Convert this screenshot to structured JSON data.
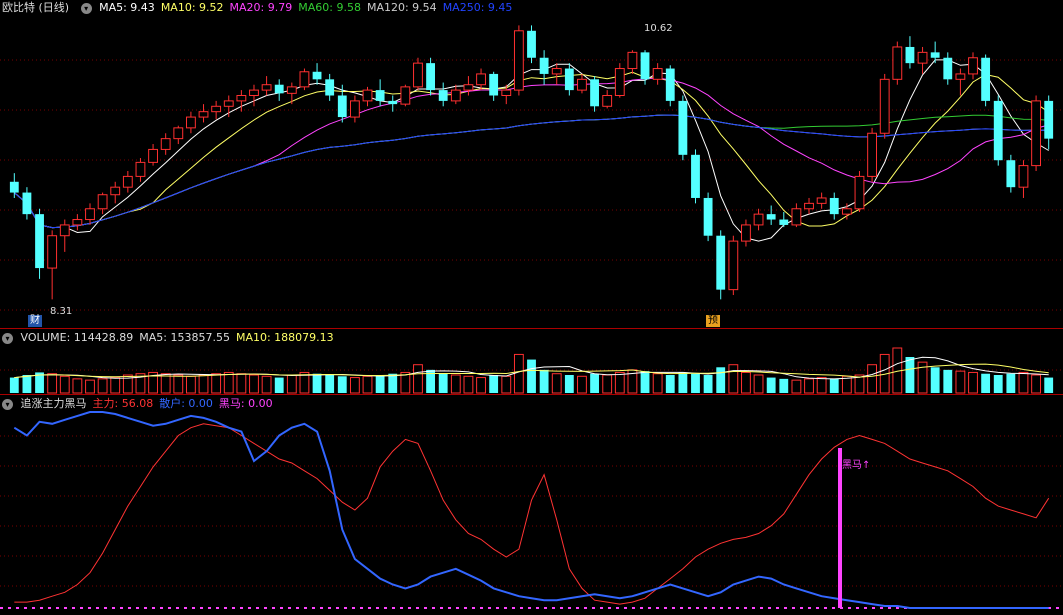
{
  "main": {
    "title": "欧比特 (日线)",
    "ma": [
      {
        "label": "MA5: 9.43",
        "color": "#ffffff"
      },
      {
        "label": "MA10: 9.52",
        "color": "#ffff66"
      },
      {
        "label": "MA20: 9.79",
        "color": "#ff44ff"
      },
      {
        "label": "MA60: 9.58",
        "color": "#33cc33"
      },
      {
        "label": "MA120: 9.54",
        "color": "#cccccc"
      },
      {
        "label": "MA250: 9.45",
        "color": "#2244ff"
      }
    ],
    "high_label": "10.62",
    "low_label": "8.31",
    "marker_cai": "财",
    "marker_yu": "预"
  },
  "volume": {
    "items": [
      {
        "label": "VOLUME: 114428.89",
        "color": "#dddddd"
      },
      {
        "label": "MA5: 153857.55",
        "color": "#dddddd"
      },
      {
        "label": "MA10: 188079.13",
        "color": "#ffff66"
      }
    ]
  },
  "indicator": {
    "items": [
      {
        "label": "追涨主力黑马",
        "color": "#dddddd"
      },
      {
        "label": "主力: 56.08",
        "color": "#ff3333"
      },
      {
        "label": "散户: 0.00",
        "color": "#3366ff"
      },
      {
        "label": "黑马: 0.00",
        "color": "#ff44ff"
      }
    ],
    "marker_label": "黑马↑"
  },
  "chart_data": [
    {
      "type": "candlestick",
      "ylim": [
        8.1,
        10.9
      ],
      "candles": [
        [
          9.4,
          9.48,
          9.25,
          9.3
        ],
        [
          9.3,
          9.35,
          9.05,
          9.1
        ],
        [
          9.1,
          9.15,
          8.5,
          8.6
        ],
        [
          8.6,
          8.95,
          8.31,
          8.9
        ],
        [
          8.9,
          9.05,
          8.75,
          9.0
        ],
        [
          9.0,
          9.1,
          8.95,
          9.05
        ],
        [
          9.05,
          9.2,
          9.0,
          9.15
        ],
        [
          9.15,
          9.3,
          9.1,
          9.28
        ],
        [
          9.28,
          9.4,
          9.2,
          9.35
        ],
        [
          9.35,
          9.5,
          9.3,
          9.45
        ],
        [
          9.45,
          9.62,
          9.4,
          9.58
        ],
        [
          9.58,
          9.75,
          9.55,
          9.7
        ],
        [
          9.7,
          9.85,
          9.65,
          9.8
        ],
        [
          9.8,
          9.92,
          9.75,
          9.9
        ],
        [
          9.9,
          10.05,
          9.85,
          10.0
        ],
        [
          10.0,
          10.12,
          9.95,
          10.05
        ],
        [
          10.05,
          10.15,
          9.98,
          10.1
        ],
        [
          10.1,
          10.2,
          10.0,
          10.15
        ],
        [
          10.15,
          10.25,
          10.05,
          10.2
        ],
        [
          10.2,
          10.3,
          10.1,
          10.25
        ],
        [
          10.25,
          10.38,
          10.2,
          10.3
        ],
        [
          10.3,
          10.35,
          10.15,
          10.22
        ],
        [
          10.22,
          10.32,
          10.12,
          10.28
        ],
        [
          10.28,
          10.45,
          10.25,
          10.42
        ],
        [
          10.42,
          10.5,
          10.3,
          10.35
        ],
        [
          10.35,
          10.4,
          10.15,
          10.2
        ],
        [
          10.2,
          10.3,
          9.95,
          10.0
        ],
        [
          10.0,
          10.2,
          9.95,
          10.15
        ],
        [
          10.15,
          10.28,
          10.1,
          10.25
        ],
        [
          10.25,
          10.35,
          10.1,
          10.15
        ],
        [
          10.15,
          10.2,
          10.05,
          10.12
        ],
        [
          10.12,
          10.3,
          10.1,
          10.28
        ],
        [
          10.28,
          10.55,
          10.25,
          10.5
        ],
        [
          10.5,
          10.55,
          10.2,
          10.25
        ],
        [
          10.25,
          10.32,
          10.1,
          10.15
        ],
        [
          10.15,
          10.3,
          10.12,
          10.25
        ],
        [
          10.25,
          10.38,
          10.2,
          10.3
        ],
        [
          10.3,
          10.45,
          10.25,
          10.4
        ],
        [
          10.4,
          10.42,
          10.15,
          10.2
        ],
        [
          10.2,
          10.3,
          10.12,
          10.25
        ],
        [
          10.25,
          10.85,
          10.2,
          10.8
        ],
        [
          10.8,
          10.85,
          10.5,
          10.55
        ],
        [
          10.55,
          10.62,
          10.3,
          10.4
        ],
        [
          10.4,
          10.5,
          10.3,
          10.45
        ],
        [
          10.45,
          10.5,
          10.2,
          10.25
        ],
        [
          10.25,
          10.4,
          10.22,
          10.35
        ],
        [
          10.35,
          10.38,
          10.05,
          10.1
        ],
        [
          10.1,
          10.25,
          10.08,
          10.2
        ],
        [
          10.2,
          10.5,
          10.18,
          10.45
        ],
        [
          10.45,
          10.62,
          10.4,
          10.6
        ],
        [
          10.6,
          10.62,
          10.3,
          10.35
        ],
        [
          10.35,
          10.5,
          10.3,
          10.45
        ],
        [
          10.45,
          10.48,
          10.1,
          10.15
        ],
        [
          10.15,
          10.2,
          9.6,
          9.65
        ],
        [
          9.65,
          9.7,
          9.2,
          9.25
        ],
        [
          9.25,
          9.3,
          8.85,
          8.9
        ],
        [
          8.9,
          8.95,
          8.31,
          8.4
        ],
        [
          8.4,
          8.9,
          8.35,
          8.85
        ],
        [
          8.85,
          9.05,
          8.8,
          9.0
        ],
        [
          9.0,
          9.15,
          8.95,
          9.1
        ],
        [
          9.1,
          9.18,
          9.0,
          9.05
        ],
        [
          9.05,
          9.12,
          8.98,
          9.0
        ],
        [
          9.0,
          9.2,
          8.98,
          9.15
        ],
        [
          9.15,
          9.25,
          9.1,
          9.2
        ],
        [
          9.2,
          9.3,
          9.15,
          9.25
        ],
        [
          9.25,
          9.3,
          9.05,
          9.1
        ],
        [
          9.1,
          9.2,
          9.05,
          9.15
        ],
        [
          9.15,
          9.5,
          9.12,
          9.45
        ],
        [
          9.45,
          9.9,
          9.4,
          9.85
        ],
        [
          9.85,
          10.4,
          9.8,
          10.35
        ],
        [
          10.35,
          10.7,
          10.3,
          10.65
        ],
        [
          10.65,
          10.75,
          10.45,
          10.5
        ],
        [
          10.5,
          10.65,
          10.4,
          10.6
        ],
        [
          10.6,
          10.7,
          10.5,
          10.55
        ],
        [
          10.55,
          10.6,
          10.3,
          10.35
        ],
        [
          10.35,
          10.45,
          10.2,
          10.4
        ],
        [
          10.4,
          10.6,
          10.35,
          10.55
        ],
        [
          10.55,
          10.58,
          10.1,
          10.15
        ],
        [
          10.15,
          10.2,
          9.55,
          9.6
        ],
        [
          9.6,
          9.65,
          9.3,
          9.35
        ],
        [
          9.35,
          9.6,
          9.25,
          9.55
        ],
        [
          9.55,
          10.2,
          9.5,
          10.15
        ],
        [
          10.15,
          10.2,
          9.7,
          9.8
        ]
      ]
    },
    {
      "type": "bar",
      "series_volume": [
        12,
        14,
        16,
        15,
        13,
        11,
        10,
        11,
        12,
        14,
        15,
        16,
        15,
        14,
        13,
        14,
        15,
        16,
        15,
        14,
        13,
        12,
        14,
        16,
        15,
        14,
        13,
        12,
        13,
        14,
        15,
        16,
        22,
        18,
        15,
        14,
        13,
        12,
        14,
        13,
        30,
        26,
        18,
        15,
        14,
        13,
        15,
        14,
        16,
        18,
        17,
        15,
        14,
        16,
        15,
        14,
        20,
        22,
        16,
        14,
        12,
        11,
        10,
        11,
        12,
        11,
        13,
        14,
        22,
        30,
        35,
        28,
        24,
        20,
        18,
        17,
        16,
        15,
        14,
        15,
        16,
        14,
        12
      ]
    },
    {
      "type": "line",
      "ylim": [
        0,
        100
      ],
      "series": [
        {
          "name": "主力",
          "color": "#ff3333",
          "values": [
            3,
            3,
            4,
            6,
            8,
            12,
            18,
            28,
            40,
            52,
            62,
            72,
            80,
            88,
            92,
            94,
            93,
            92,
            88,
            84,
            80,
            76,
            74,
            70,
            66,
            60,
            54,
            50,
            56,
            72,
            80,
            86,
            84,
            70,
            55,
            45,
            38,
            35,
            30,
            26,
            30,
            55,
            68,
            45,
            20,
            10,
            4,
            3,
            2,
            3,
            5,
            10,
            15,
            20,
            26,
            30,
            33,
            35,
            36,
            38,
            42,
            48,
            58,
            68,
            76,
            82,
            86,
            88,
            86,
            84,
            80,
            76,
            74,
            72,
            70,
            66,
            62,
            56,
            52,
            50,
            48,
            46,
            56
          ]
        },
        {
          "name": "散户",
          "color": "#3366ff",
          "values": [
            92,
            88,
            95,
            94,
            96,
            98,
            100,
            100,
            99,
            97,
            95,
            93,
            94,
            96,
            98,
            97,
            95,
            92,
            90,
            75,
            80,
            88,
            92,
            94,
            90,
            70,
            40,
            25,
            20,
            15,
            12,
            10,
            12,
            16,
            18,
            20,
            17,
            14,
            10,
            8,
            6,
            5,
            4,
            4,
            5,
            6,
            7,
            6,
            5,
            6,
            8,
            10,
            12,
            10,
            8,
            6,
            8,
            12,
            14,
            16,
            15,
            12,
            10,
            8,
            6,
            5,
            4,
            3,
            2,
            1,
            1,
            0,
            0,
            0,
            0,
            0,
            0,
            0,
            0,
            0,
            0,
            0,
            0
          ]
        }
      ]
    }
  ]
}
